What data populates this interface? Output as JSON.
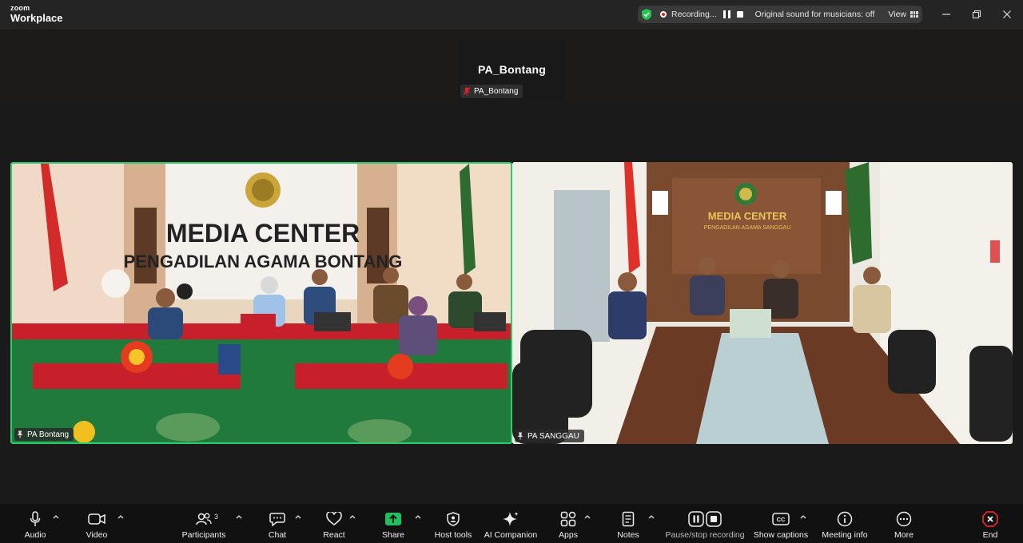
{
  "app": {
    "brand_top": "zoom",
    "brand_bottom": "Workplace"
  },
  "recording_bar": {
    "status": "Recording...",
    "sound": "Original sound for musicians: off",
    "view_label": "View"
  },
  "participants_strip": {
    "name_large": "PA_Bontang",
    "name_tag": "PA_Bontang"
  },
  "video_tiles": [
    {
      "label": "PA Bontang",
      "sign_line1": "MEDIA CENTER",
      "sign_line2": "PENGADILAN AGAMA BONTANG",
      "active_speaker": true
    },
    {
      "label": "PA SANGGAU",
      "sign_line1": "MEDIA CENTER",
      "sign_line2": "PENGADILAN AGAMA SANGGAU",
      "active_speaker": false
    }
  ],
  "toolbar": {
    "audio": "Audio",
    "video": "Video",
    "participants": "Participants",
    "participants_count": "3",
    "chat": "Chat",
    "react": "React",
    "share": "Share",
    "host_tools": "Host tools",
    "ai_companion": "AI Companion",
    "apps": "Apps",
    "notes": "Notes",
    "pause_stop": "Pause/stop recording",
    "captions": "Show captions",
    "meeting_info": "Meeting info",
    "more": "More",
    "end": "End"
  },
  "colors": {
    "active_border": "#2ecc71",
    "share_green": "#1fbf5f",
    "end_red": "#e0232a",
    "background": "#1a1a1a"
  }
}
